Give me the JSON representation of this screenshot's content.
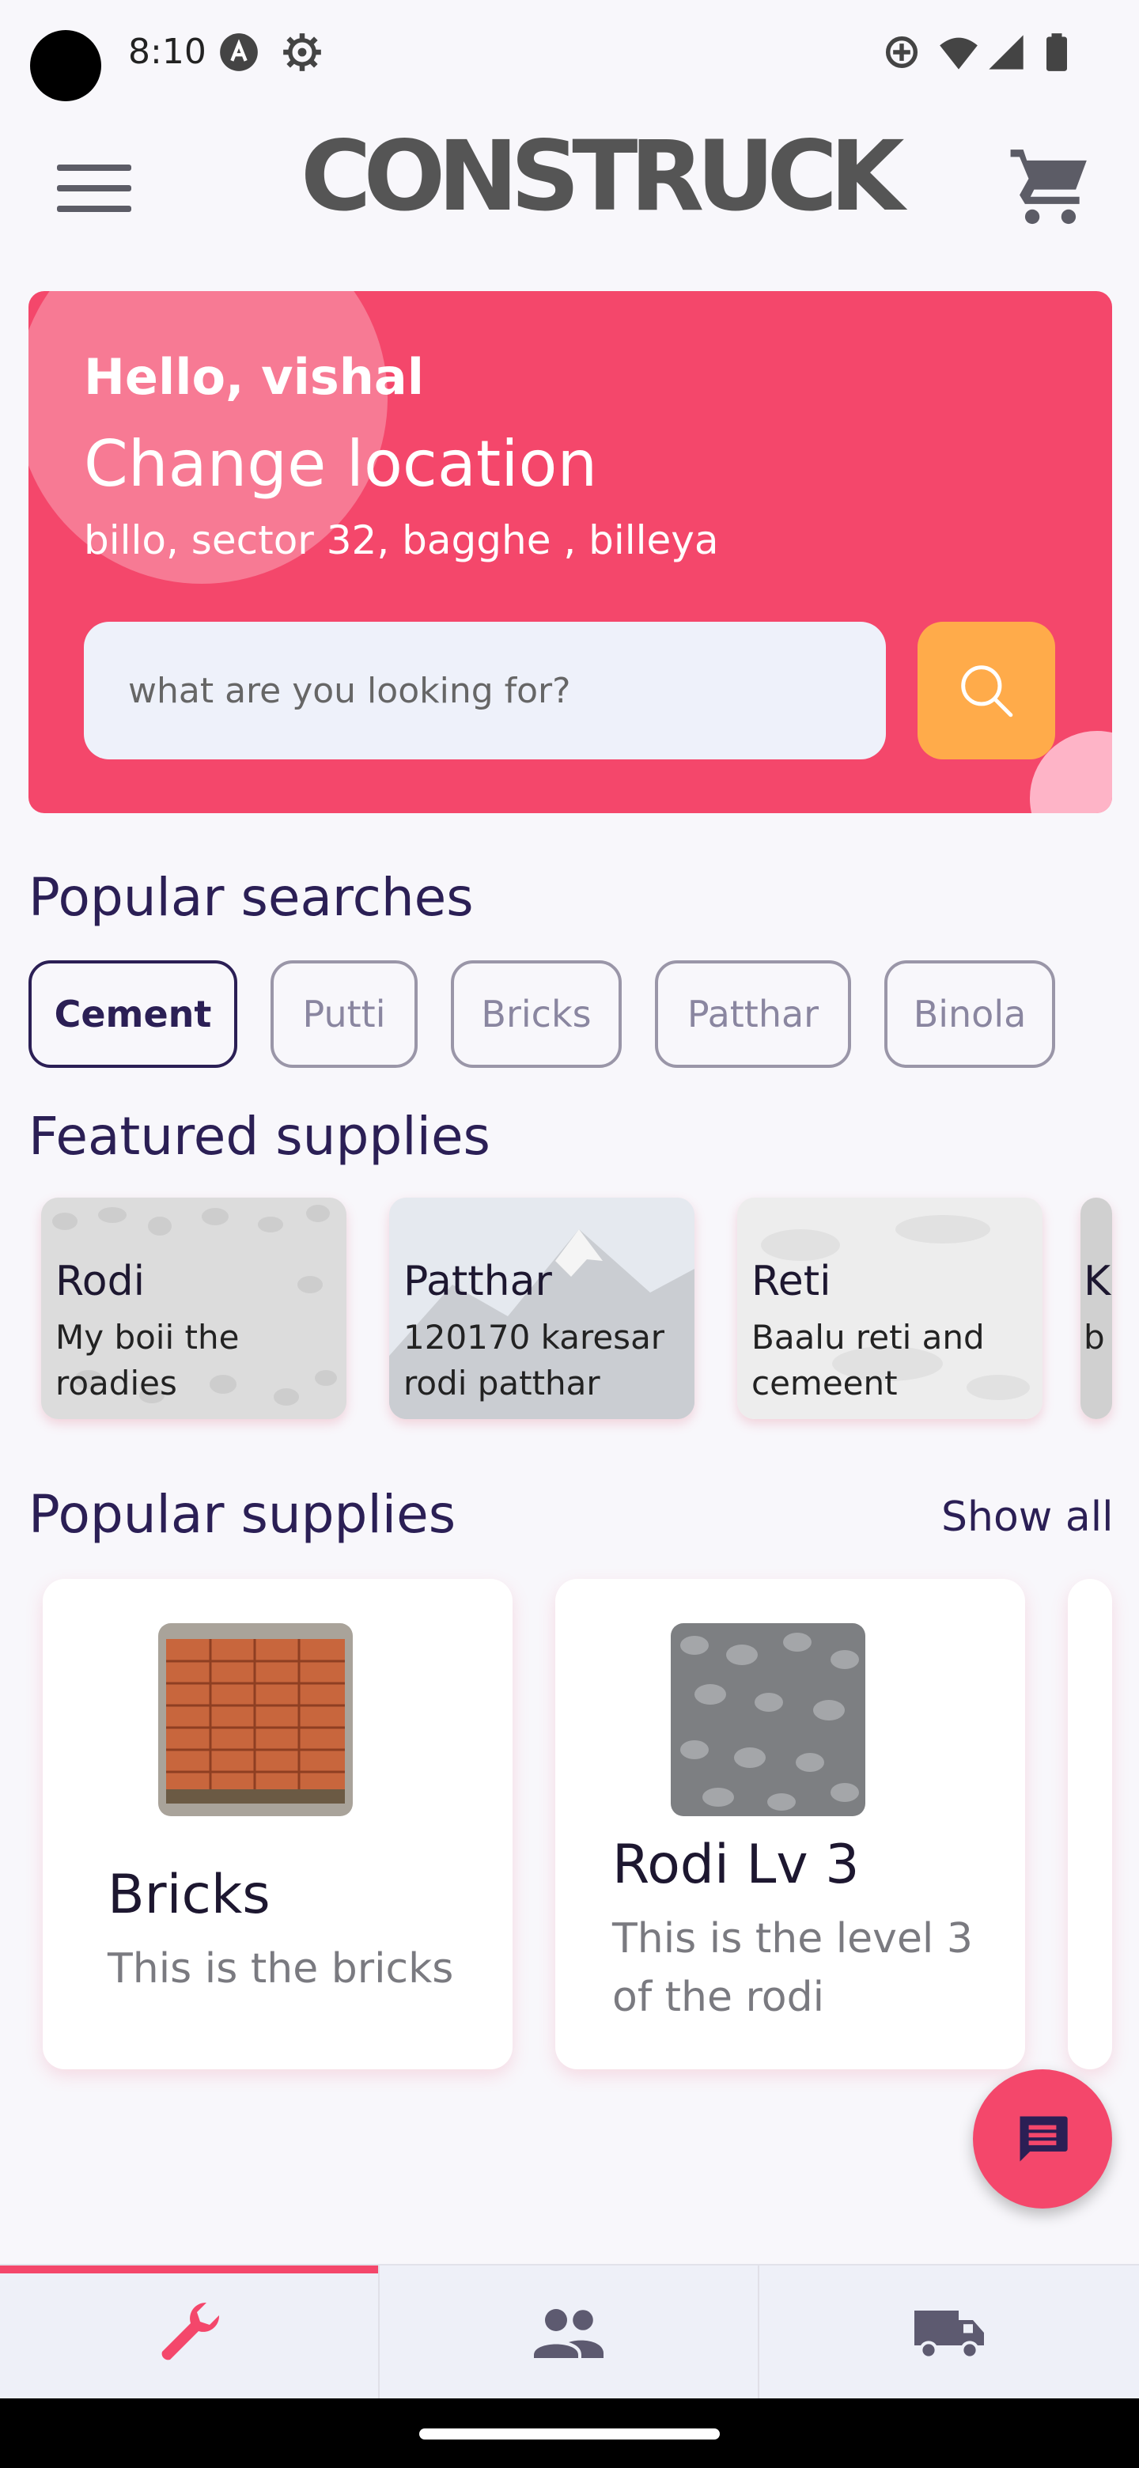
{
  "status_bar": {
    "time": "8:10",
    "icons": [
      "a-circle-icon",
      "settings-icon",
      "sync-icon",
      "wifi-icon",
      "signal-icon",
      "battery-icon"
    ]
  },
  "app_bar": {
    "brand": "CONSTRUCK",
    "menu_icon": "hamburger-menu-icon",
    "cart_icon": "shopping-cart-icon"
  },
  "hero": {
    "greeting": "Hello, vishal",
    "change_location": "Change location",
    "address": "billo, sector 32, bagghe , billeya",
    "search_placeholder": "what are you looking for?",
    "search_icon": "search-icon",
    "colors": {
      "background": "#f4476b",
      "search_button": "#ffab4a"
    }
  },
  "popular_searches": {
    "title": "Popular searches",
    "chips": [
      {
        "label": "Cement",
        "selected": true
      },
      {
        "label": "Putti",
        "selected": false
      },
      {
        "label": "Bricks",
        "selected": false
      },
      {
        "label": "Patthar",
        "selected": false
      },
      {
        "label": "Binola",
        "selected": false
      }
    ]
  },
  "featured_supplies": {
    "title": "Featured supplies",
    "items": [
      {
        "title": "Rodi",
        "description": "My boii the roadies"
      },
      {
        "title": "Patthar",
        "description": "120170 karesar rodi patthar"
      },
      {
        "title": "Reti",
        "description": "Baalu reti and cemeent"
      },
      {
        "title": "K",
        "description": "b"
      }
    ]
  },
  "popular_supplies": {
    "title": "Popular supplies",
    "show_all": "Show all",
    "items": [
      {
        "title": "Bricks",
        "description": "This is the bricks"
      },
      {
        "title": "Rodi Lv 3",
        "description": "This is the level 3 of the rodi"
      }
    ]
  },
  "fab": {
    "icon": "chat-icon"
  },
  "bottom_nav": {
    "tabs": [
      {
        "icon": "wrench-icon",
        "active": true
      },
      {
        "icon": "people-icon",
        "active": false
      },
      {
        "icon": "truck-icon",
        "active": false
      }
    ],
    "accent": "#f4476b"
  }
}
